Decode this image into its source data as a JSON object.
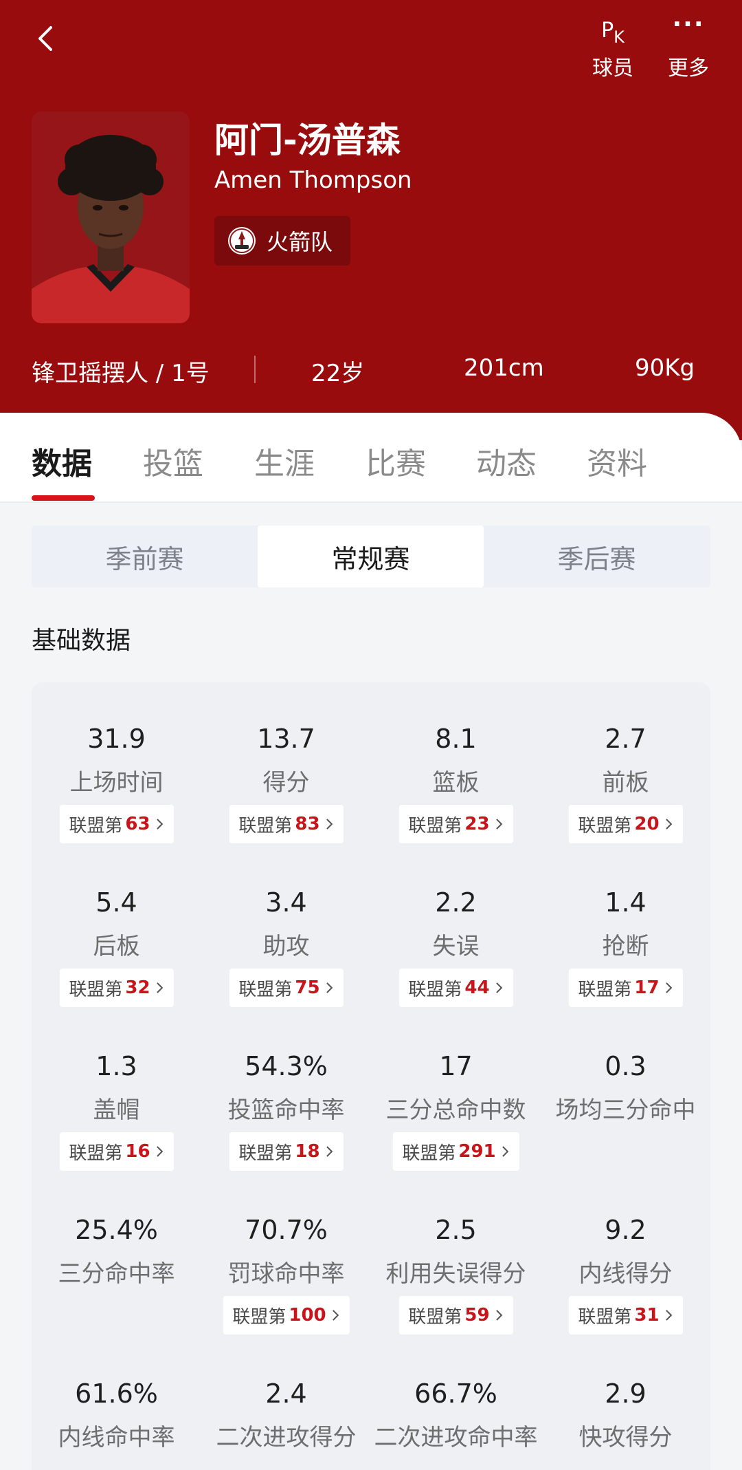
{
  "header": {
    "pk_label": "球员",
    "more_label": "更多"
  },
  "player": {
    "name_cn": "阿门-汤普森",
    "name_en": "Amen Thompson",
    "team": "火箭队",
    "position_number": "锋卫摇摆人 / 1号",
    "age": "22岁",
    "height": "201cm",
    "weight": "90Kg"
  },
  "tabs": [
    "数据",
    "投篮",
    "生涯",
    "比赛",
    "动态",
    "资料"
  ],
  "season_types": [
    "季前赛",
    "常规赛",
    "季后赛"
  ],
  "section_title": "基础数据",
  "rank_prefix": "联盟第",
  "stats": [
    {
      "value": "31.9",
      "label": "上场时间",
      "rank": "63"
    },
    {
      "value": "13.7",
      "label": "得分",
      "rank": "83"
    },
    {
      "value": "8.1",
      "label": "篮板",
      "rank": "23"
    },
    {
      "value": "2.7",
      "label": "前板",
      "rank": "20"
    },
    {
      "value": "5.4",
      "label": "后板",
      "rank": "32"
    },
    {
      "value": "3.4",
      "label": "助攻",
      "rank": "75"
    },
    {
      "value": "2.2",
      "label": "失误",
      "rank": "44"
    },
    {
      "value": "1.4",
      "label": "抢断",
      "rank": "17"
    },
    {
      "value": "1.3",
      "label": "盖帽",
      "rank": "16"
    },
    {
      "value": "54.3%",
      "label": "投篮命中率",
      "rank": "18"
    },
    {
      "value": "17",
      "label": "三分总命中数",
      "rank": "291"
    },
    {
      "value": "0.3",
      "label": "场均三分命中",
      "rank": null
    },
    {
      "value": "25.4%",
      "label": "三分命中率",
      "rank": null
    },
    {
      "value": "70.7%",
      "label": "罚球命中率",
      "rank": "100"
    },
    {
      "value": "2.5",
      "label": "利用失误得分",
      "rank": "59"
    },
    {
      "value": "9.2",
      "label": "内线得分",
      "rank": "31"
    },
    {
      "value": "61.6%",
      "label": "内线命中率",
      "rank": null
    },
    {
      "value": "2.4",
      "label": "二次进攻得分",
      "rank": null
    },
    {
      "value": "66.7%",
      "label": "二次进攻命中率",
      "rank": null
    },
    {
      "value": "2.9",
      "label": "快攻得分",
      "rank": null
    }
  ],
  "colors": {
    "header_red": "#990c0e",
    "accent_red": "#d8141a",
    "rank_red": "#c8141a"
  }
}
